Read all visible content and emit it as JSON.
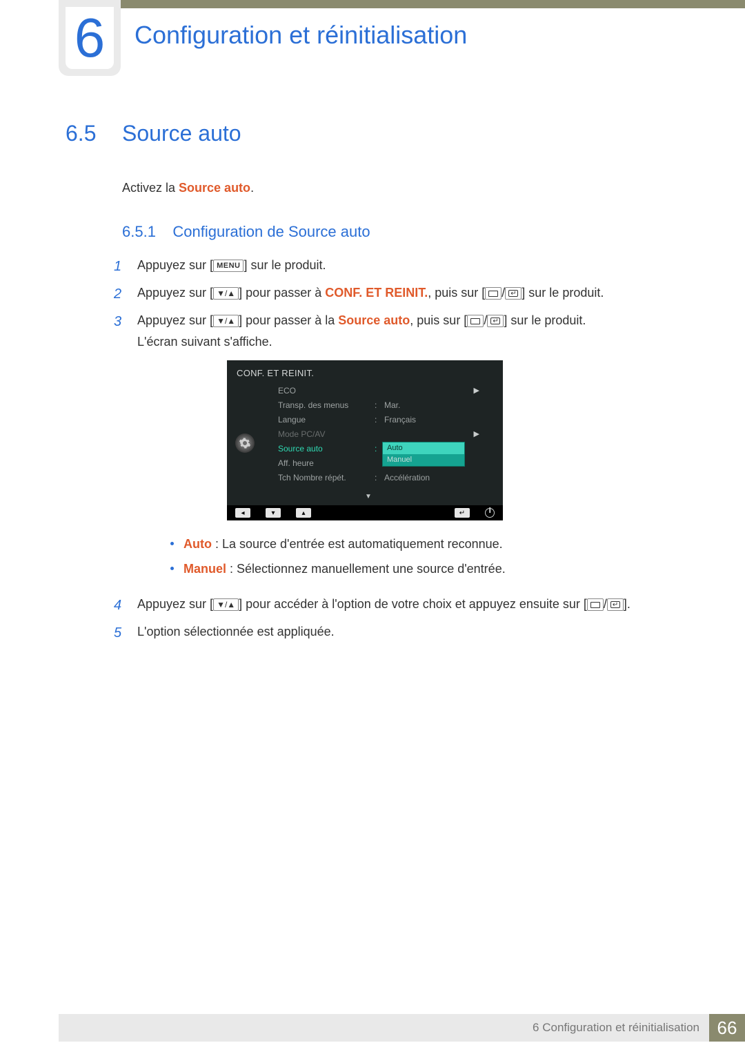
{
  "chapter": {
    "number": "6",
    "title": "Configuration et réinitialisation"
  },
  "section": {
    "number": "6.5",
    "title": "Source auto"
  },
  "intro": {
    "prefix": "Activez la ",
    "highlight": "Source auto",
    "suffix": "."
  },
  "subsection": {
    "number": "6.5.1",
    "title": "Configuration de Source auto"
  },
  "steps": {
    "s1": {
      "num": "1",
      "before": "Appuyez sur [",
      "menu": "MENU",
      "after": "] sur le produit."
    },
    "s2": {
      "num": "2",
      "before": "Appuyez sur [",
      "mid1": "] pour passer à ",
      "hl": "CONF. ET REINIT.",
      "mid2": ", puis sur [",
      "after": "] sur le produit."
    },
    "s3": {
      "num": "3",
      "before": "Appuyez sur [",
      "mid1": "] pour passer à la ",
      "hl": "Source auto",
      "mid2": ", puis sur [",
      "after": "] sur le produit.",
      "line2": "L'écran suivant s'affiche."
    },
    "s4": {
      "num": "4",
      "before": "Appuyez sur [",
      "mid1": "] pour accéder à l'option de votre choix et appuyez ensuite sur [",
      "after": "]."
    },
    "s5": {
      "num": "5",
      "text": "L'option sélectionnée est appliquée."
    }
  },
  "osd": {
    "title": "CONF. ET REINIT.",
    "rows": {
      "eco": {
        "label": "ECO"
      },
      "transp": {
        "label": "Transp. des menus",
        "value": "Mar."
      },
      "langue": {
        "label": "Langue",
        "value": "Français"
      },
      "mode": {
        "label": "Mode PC/AV"
      },
      "source": {
        "label": "Source auto"
      },
      "aff": {
        "label": "Aff. heure"
      },
      "tch": {
        "label": "Tch Nombre répét.",
        "value": "Accélération"
      }
    },
    "dropdown": {
      "opt1": "Auto",
      "opt2": "Manuel"
    }
  },
  "bullets": {
    "auto": {
      "hl": "Auto",
      "text": " : La source d'entrée est automatiquement reconnue."
    },
    "manuel": {
      "hl": "Manuel",
      "text": " : Sélectionnez manuellement une source d'entrée."
    }
  },
  "footer": {
    "label_num": "6",
    "label_text": "Configuration et réinitialisation",
    "page": "66"
  }
}
